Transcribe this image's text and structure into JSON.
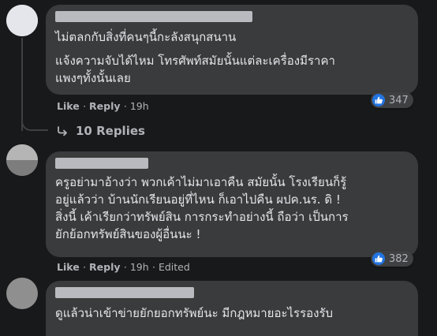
{
  "comments": [
    {
      "lines": [
        "ไม่ตลกกับสิ่งที่คนๆนี้กะลังสนุกสนาน",
        "แจ้งความจับได้ไหม โทรศัพท์สมัยนั้นแต่ละเครื่องมีราคา",
        "แพงๆทั้งนั้นเลย"
      ],
      "like_label": "Like",
      "reply_label": "Reply",
      "time": "19h",
      "reaction_count": "347"
    },
    {
      "lines": [
        "ครูอย่ามาอ้างว่า พวกเค้าไม่มาเอาคืน สมัยนั้น โรงเรียนก็รู้",
        "อยู่แล้วว่า บ้านนักเรียนอยู่ที่ไหน ก็เอาไปคืน ผปค.นร. ดิ !",
        "สิ่งนี้ เค้าเรียกว่าทรัพย์สิน การกระทำอย่างนี้ ถือว่า เป็นการ",
        "ยักย้อกทรัพย์สินของผู้อื่นนะ !"
      ],
      "like_label": "Like",
      "reply_label": "Reply",
      "time": "19h",
      "edited_label": "Edited",
      "reaction_count": "382"
    },
    {
      "lines": [
        "ดูแล้วน่าเข้าข่ายยักยอกทรัพย์นะ มีกฎหมายอะไรรองรับ"
      ]
    }
  ],
  "replies_link": "10 Replies",
  "colors": {
    "background": "#18191a",
    "bubble": "#3a3b3c",
    "text": "#e4e6eb",
    "muted": "#b0b3b8",
    "like_blue": "#2374e1"
  },
  "icons": {
    "reaction": "thumbs-up-icon",
    "replies": "reply-arrow-icon"
  }
}
